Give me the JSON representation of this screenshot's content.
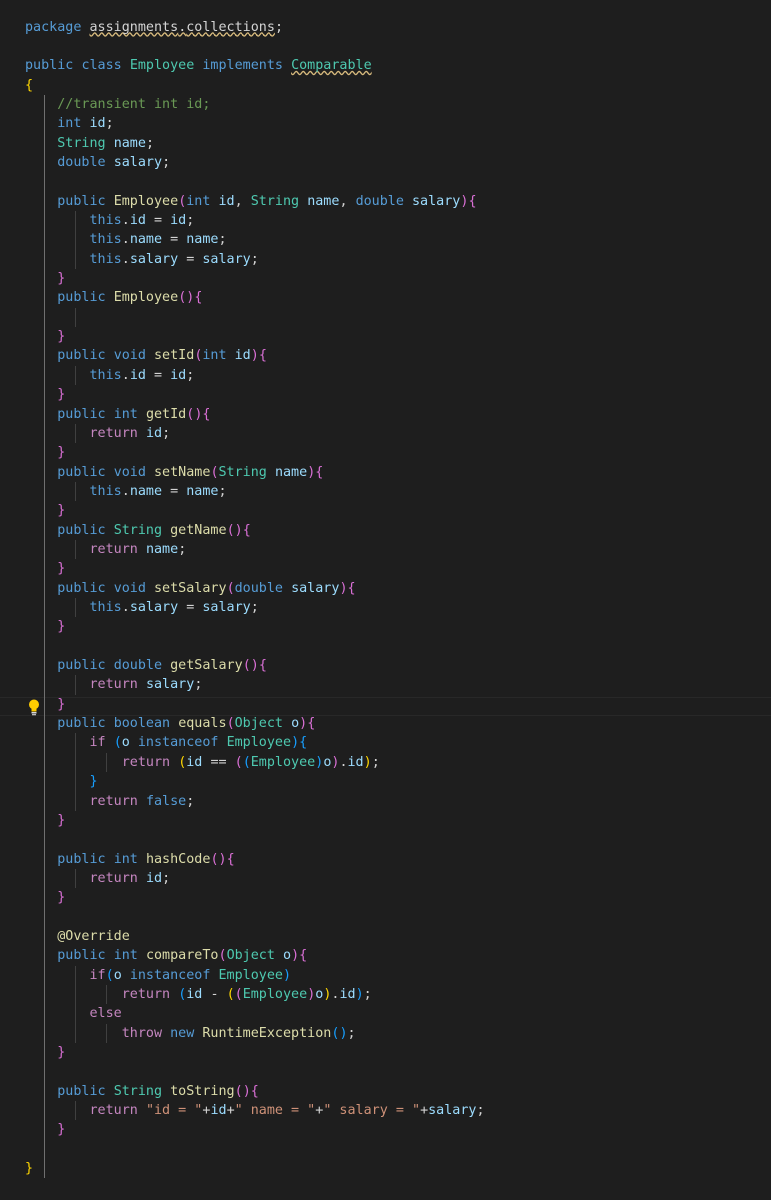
{
  "editor": {
    "language": "java",
    "theme": "dark",
    "active_line": 36,
    "lightbulb_icon": "lightbulb-icon",
    "diagnostics": [
      {
        "line": 0,
        "text": "assignments.collections",
        "kind": "warning"
      },
      {
        "line": 2,
        "text": "Comparable",
        "kind": "warning"
      }
    ],
    "lines": [
      "package assignments.collections;",
      "",
      "public class Employee implements Comparable",
      "{",
      "    //transient int id;",
      "    int id;",
      "    String name;",
      "    double salary;",
      "",
      "    public Employee(int id, String name, double salary){",
      "        this.id = id;",
      "        this.name = name;",
      "        this.salary = salary;",
      "    }",
      "    public Employee(){",
      "",
      "    }",
      "    public void setId(int id){",
      "        this.id = id;",
      "    }",
      "    public int getId(){",
      "        return id;",
      "    }",
      "    public void setName(String name){",
      "        this.name = name;",
      "    }",
      "    public String getName(){",
      "        return name;",
      "    }",
      "    public void setSalary(double salary){",
      "        this.salary = salary;",
      "    }",
      "",
      "    public double getSalary(){",
      "        return salary;",
      "    }",
      "    public boolean equals(Object o){",
      "        if (o instanceof Employee){",
      "            return (id == ((Employee)o).id);",
      "        }",
      "        return false;",
      "    }",
      "",
      "    public int hashCode(){",
      "        return id;",
      "    }",
      "",
      "    @Override",
      "    public int compareTo(Object o){",
      "        if(o instanceof Employee)",
      "            return (id - ((Employee)o).id);",
      "        else",
      "            throw new RuntimeException();",
      "    }",
      "",
      "    public String toString(){",
      "        return \"id = \"+id+\" name = \"+\" salary = \"+salary;",
      "    }",
      "",
      "}"
    ]
  },
  "colors": {
    "background": "#1e1e1e",
    "keyword": "#569cd6",
    "control": "#c586c0",
    "type": "#4ec9b0",
    "function": "#dcdcaa",
    "variable": "#9cdcfe",
    "string": "#ce9178",
    "comment": "#6a9955",
    "bracket_gold": "#ffd700",
    "bracket_pink": "#da70d6",
    "bracket_blue": "#179fff"
  }
}
